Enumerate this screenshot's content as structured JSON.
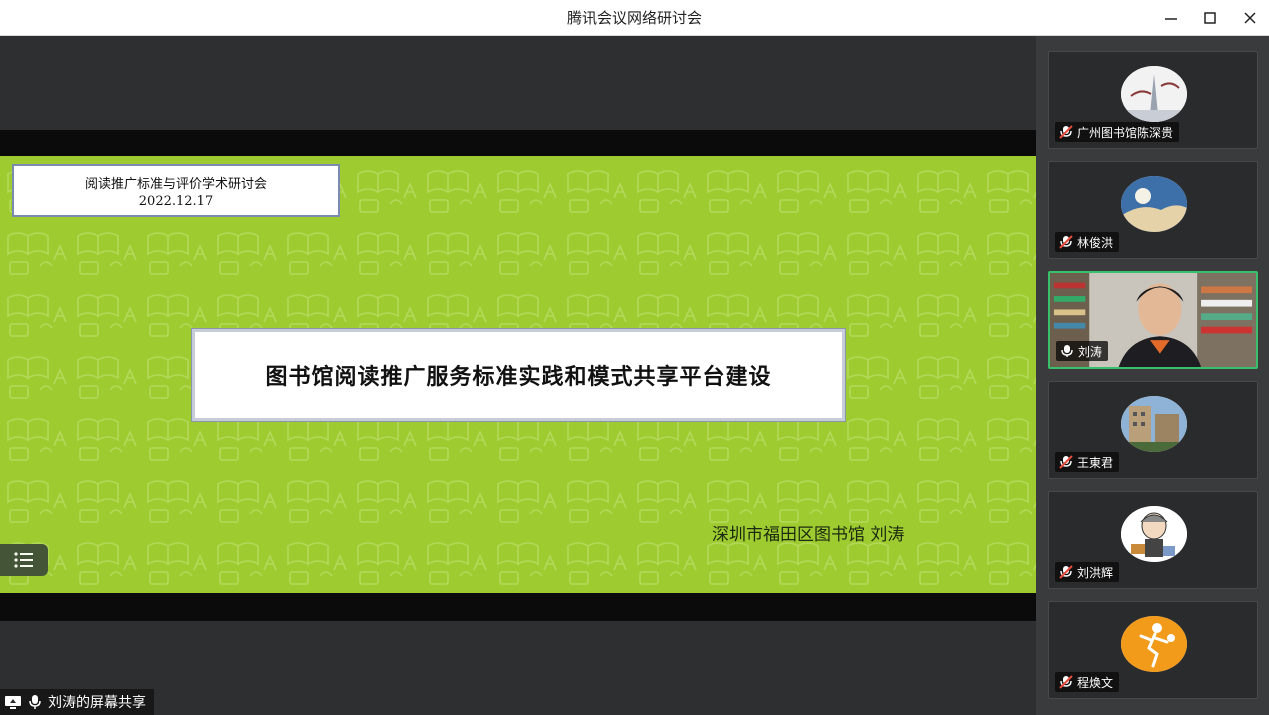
{
  "window": {
    "title": "腾讯会议网络研讨会",
    "minimize_icon": "minimize-icon",
    "maximize_icon": "maximize-icon",
    "close_icon": "close-icon"
  },
  "slide": {
    "event_name": "阅读推广标准与评价学术研讨会",
    "event_date": "2022.12.17",
    "main_title": "图书馆阅读推广服务标准实践和模式共享平台建设",
    "author": "深圳市福田区图书馆  刘涛",
    "background_color": "#9ecb30"
  },
  "share": {
    "label": "刘涛的屏幕共享",
    "icons": [
      "screen-share-icon",
      "mic-icon"
    ]
  },
  "participants": [
    {
      "name": "广州图书馆陈深贵",
      "muted": true,
      "video": false,
      "avatar": "city-tower-avatar"
    },
    {
      "name": "林俊洪",
      "muted": true,
      "video": false,
      "avatar": "beach-moon-avatar"
    },
    {
      "name": "刘涛",
      "muted": false,
      "video": true,
      "active": true,
      "avatar": "webcam-video"
    },
    {
      "name": "王東君",
      "muted": true,
      "video": false,
      "avatar": "building-avatar"
    },
    {
      "name": "刘洪辉",
      "muted": true,
      "video": false,
      "avatar": "cartoon-avatar"
    },
    {
      "name": "程焕文",
      "muted": true,
      "video": false,
      "avatar": "basketball-avatar"
    }
  ],
  "colors": {
    "active_border": "#39c06a",
    "muted_icon": "#e94b3c"
  }
}
